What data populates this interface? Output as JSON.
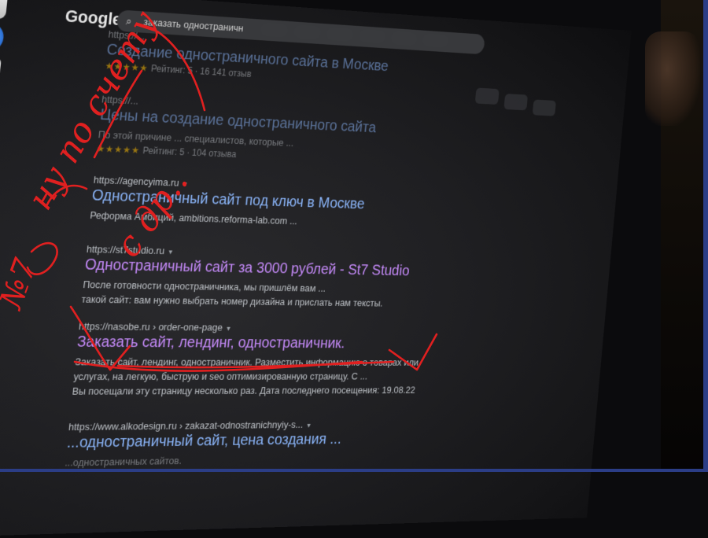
{
  "browser": {
    "logo": "Google",
    "search_query": "заказать одностраничн",
    "search_icon": "search-icon"
  },
  "results": [
    {
      "url": "https://...",
      "title": "Создание одностраничного сайта в Москве",
      "snippet": "",
      "rating": "Рейтинг: 5 · 16 141 отзыв"
    },
    {
      "url": "https://...",
      "title": "Цены на создание одностраничного сайта",
      "snippet": "По этой причине ... специалистов, которые ...",
      "rating": "Рейтинг: 5 · 104 отзыва"
    },
    {
      "url": "https://agencyima.ru",
      "title": "Одностраничный сайт под ключ в Москве",
      "snippet": "Реформа Амбиций, ambitions.reforma-lab.com ..."
    },
    {
      "url": "https://st7studio.ru",
      "title": "Одностраничный сайт за 3000 рублей - St7 Studio",
      "snippet_line1": "После готовности одностраничника, мы пришлём вам ...",
      "snippet_line2": "такой сайт: вам нужно выбрать номер дизайна и прислать нам тексты."
    },
    {
      "url": "https://nasobe.ru › order-one-page",
      "title": "Заказать сайт, лендинг, одностраничник.",
      "snippet_line1": "Заказать сайт, лендинг, одностраничник. Разместить информацию о товарах или",
      "snippet_line2": "услугах, на легкую, быструю и seo оптимизированную страницу. С ...",
      "snippet_line3": "Вы посещали эту страницу несколько раз. Дата последнего посещения: 19.08.22"
    },
    {
      "url": "https://www.alkodesign.ru › zakazat-odnostranichnyiy-s...",
      "title": "...одностраничный сайт, цена создания ...",
      "snippet": "...одностраничных сайтов."
    }
  ],
  "annotations": {
    "ink_color": "#e02020",
    "handwritten_1": "ну по счету",
    "handwritten_2": "с др..",
    "handwritten_3": "№7"
  }
}
